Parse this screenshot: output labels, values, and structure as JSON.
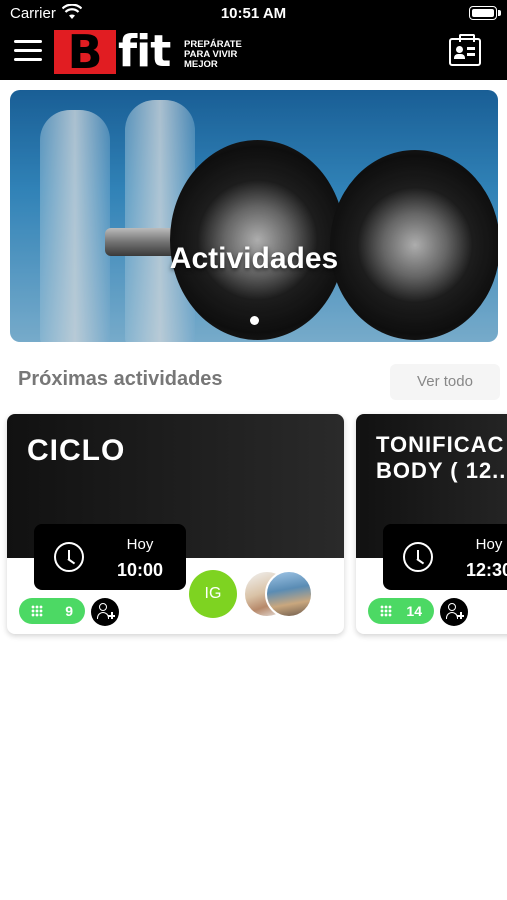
{
  "status_bar": {
    "carrier": "Carrier",
    "time": "10:51 AM"
  },
  "header": {
    "logo_letter": "B",
    "logo_word": "fit",
    "tagline": "PREPÁRATE PARA VIVIR MEJOR",
    "brand_color": "#e11d22"
  },
  "hero": {
    "title": "Actividades"
  },
  "upcoming": {
    "section_title": "Próximas actividades",
    "see_all_label": "Ver todo",
    "activities": [
      {
        "name": "CICLO",
        "day": "Hoy",
        "time": "10:00",
        "spots": "9",
        "participant_initials": "IG"
      },
      {
        "name": "TONIFICAC\nBODY ( 12...",
        "day": "Hoy",
        "time": "12:30",
        "spots": "14"
      }
    ]
  },
  "colors": {
    "spots_pill": "#4cd964",
    "initials_avatar": "#7ed321"
  }
}
